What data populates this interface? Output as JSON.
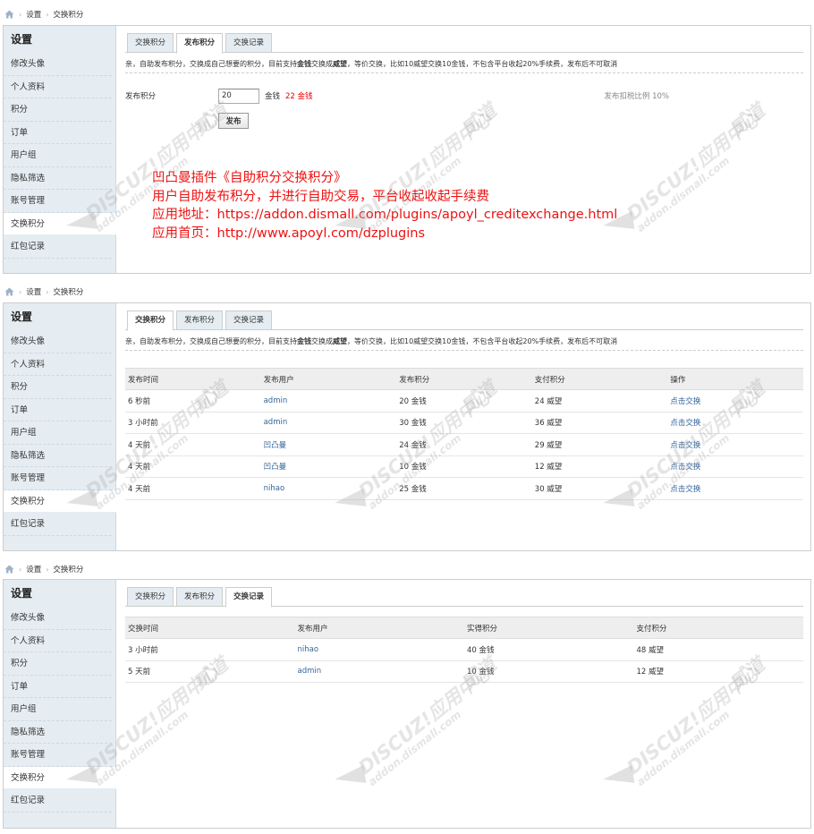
{
  "breadcrumb": {
    "home_icon": "home-icon",
    "separator": "›",
    "items": [
      "设置",
      "交换积分"
    ]
  },
  "sidebar": {
    "title": "设置",
    "items": [
      "修改头像",
      "个人资料",
      "积分",
      "订单",
      "用户组",
      "隐私筛选",
      "账号管理",
      "交换积分",
      "红包记录"
    ],
    "active": "交换积分"
  },
  "tabs": [
    "交换积分",
    "发布积分",
    "交换记录"
  ],
  "notice": {
    "prefix": "亲，自助发布积分，交换成自己想要的积分，目前支持",
    "bold1": "金钱",
    "middle": "交换成",
    "bold2": "威望",
    "suffix": "，等价交换，比如10威望交换10金钱，不包含平台收起20%手续费，发布后不可取消"
  },
  "publish_form": {
    "label": "发布积分",
    "value": "20",
    "unit": "金钱",
    "available": "22 金钱",
    "tax_note": "发布扣税比例 10%",
    "submit_label": "发布"
  },
  "promo_lines": [
    "凹凸曼插件《自助积分交换积分》",
    "用户自助发布积分，并进行自助交易，平台收起收起手续费",
    "应用地址：https://addon.dismall.com/plugins/apoyl_creditexchange.html",
    "应用首页：http://www.apoyl.com/dzplugins"
  ],
  "listing_table": {
    "headers": [
      "发布时间",
      "发布用户",
      "发布积分",
      "支付积分",
      "操作"
    ],
    "rows": [
      [
        "6 秒前",
        "admin",
        "20 金钱",
        "24 威望",
        "点击交换"
      ],
      [
        "3 小时前",
        "admin",
        "30 金钱",
        "36 威望",
        "点击交换"
      ],
      [
        "4 天前",
        "凹凸曼",
        "24 金钱",
        "29 威望",
        "点击交换"
      ],
      [
        "4 天前",
        "凹凸曼",
        "10 金钱",
        "12 威望",
        "点击交换"
      ],
      [
        "4 天前",
        "nihao",
        "25 金钱",
        "30 威望",
        "点击交换"
      ]
    ]
  },
  "history_table": {
    "headers": [
      "交换时间",
      "发布用户",
      "实得积分",
      "支付积分"
    ],
    "rows": [
      [
        "3 小时前",
        "nihao",
        "40 金钱",
        "48 威望"
      ],
      [
        "5 天前",
        "admin",
        "10 金钱",
        "12 威望"
      ]
    ]
  },
  "watermark": {
    "brand": "DISCUZ!应用中心",
    "site": "addon.dismall.com",
    "mark": "贰道"
  },
  "colors": {
    "sidebar_bg": "#e5edf2",
    "link": "#336699",
    "alert": "#ee1111"
  }
}
